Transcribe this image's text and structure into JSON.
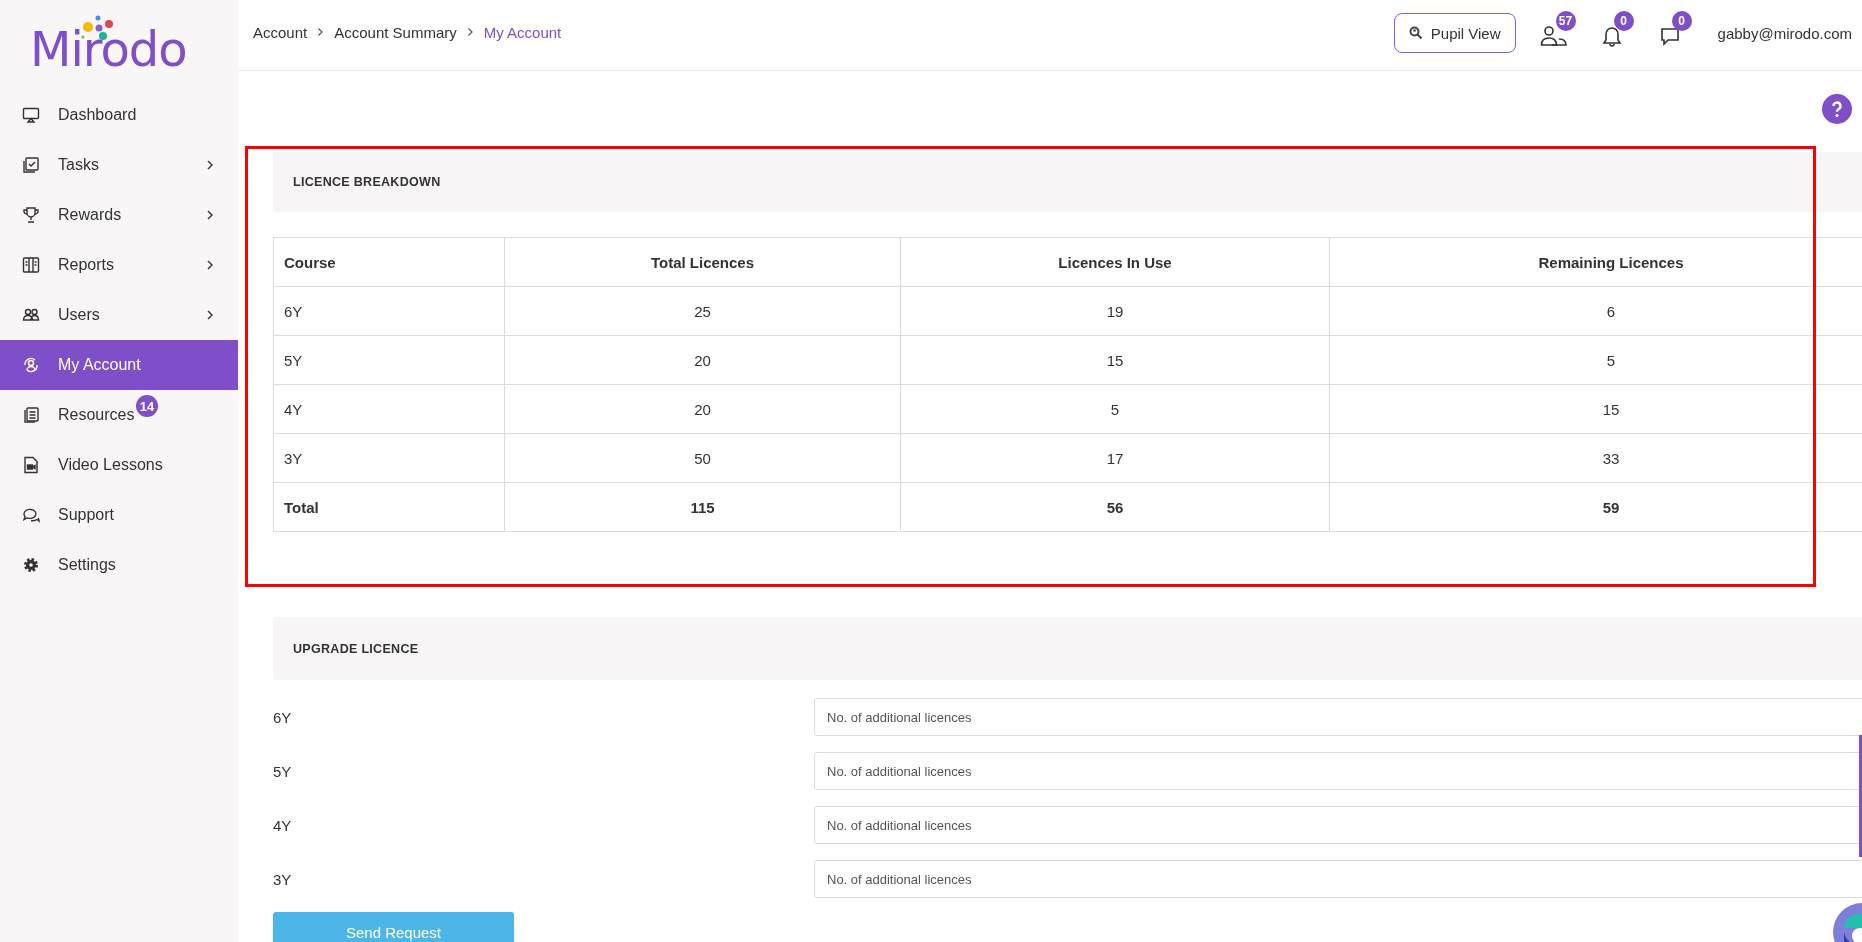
{
  "logo": {
    "text": "Mirodo"
  },
  "sidebar": {
    "items": [
      {
        "label": "Dashboard",
        "selected": false,
        "has_submenu": false
      },
      {
        "label": "Tasks",
        "selected": false,
        "has_submenu": true
      },
      {
        "label": "Rewards",
        "selected": false,
        "has_submenu": true
      },
      {
        "label": "Reports",
        "selected": false,
        "has_submenu": true
      },
      {
        "label": "Users",
        "selected": false,
        "has_submenu": true
      },
      {
        "label": "My Account",
        "selected": true,
        "has_submenu": false
      },
      {
        "label": "Resources",
        "selected": false,
        "has_submenu": false,
        "badge": "14"
      },
      {
        "label": "Video Lessons",
        "selected": false,
        "has_submenu": false
      },
      {
        "label": "Support",
        "selected": false,
        "has_submenu": false
      },
      {
        "label": "Settings",
        "selected": false,
        "has_submenu": false
      }
    ]
  },
  "breadcrumb": [
    {
      "label": "Account",
      "current": false
    },
    {
      "label": "Account Summary",
      "current": false
    },
    {
      "label": "My Account",
      "current": true
    }
  ],
  "header": {
    "pupil_view_button": "Pupil View",
    "users_badge": "57",
    "notifications_badge": "0",
    "messages_badge": "0",
    "user_email": "gabby@mirodo.com"
  },
  "licence_breakdown": {
    "title": "LICENCE BREAKDOWN",
    "columns": [
      "Course",
      "Total Licences",
      "Licences In Use",
      "Remaining Licences"
    ],
    "rows": [
      [
        "6Y",
        "25",
        "19",
        "6"
      ],
      [
        "5Y",
        "20",
        "15",
        "5"
      ],
      [
        "4Y",
        "20",
        "5",
        "15"
      ],
      [
        "3Y",
        "50",
        "17",
        "33"
      ]
    ],
    "total_row": [
      "Total",
      "115",
      "56",
      "59"
    ]
  },
  "upgrade_licence": {
    "title": "UPGRADE LICENCE",
    "rows": [
      {
        "label": "6Y",
        "placeholder": "No. of additional licences"
      },
      {
        "label": "5Y",
        "placeholder": "No. of additional licences"
      },
      {
        "label": "4Y",
        "placeholder": "No. of additional licences"
      },
      {
        "label": "3Y",
        "placeholder": "No. of additional licences"
      }
    ],
    "button": "Send Request"
  }
}
